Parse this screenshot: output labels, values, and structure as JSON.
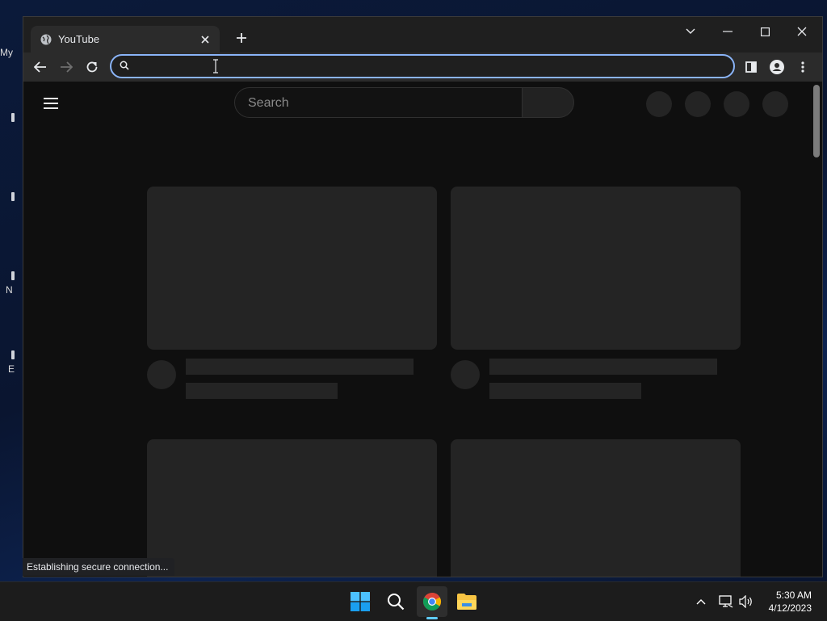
{
  "desktop": {
    "labels": [
      "My",
      "N",
      "E"
    ]
  },
  "browser": {
    "tab": {
      "title": "YouTube"
    },
    "omnibox": {
      "value": "",
      "placeholder": ""
    },
    "status_text": "Establishing secure connection..."
  },
  "youtube": {
    "search_placeholder": "Search"
  },
  "taskbar": {
    "time": "5:30 AM",
    "date": "4/12/2023",
    "apps": [
      "start",
      "search",
      "chrome",
      "file-explorer"
    ]
  },
  "colors": {
    "accent": "#8ab4f8",
    "page_bg": "#0f0f0f",
    "skeleton": "#242424",
    "taskbar_active": "#60cdff"
  }
}
